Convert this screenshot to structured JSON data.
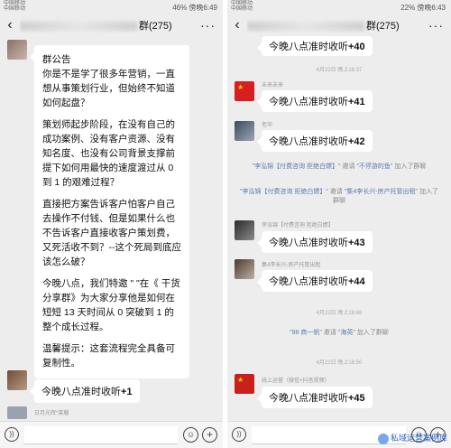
{
  "left": {
    "status": {
      "carrier_line1": "中国移动",
      "carrier_line2": "中国移动",
      "right": "46% 傍晚6:49"
    },
    "title": "群(275)",
    "announcement": {
      "heading": "群公告",
      "paragraphs": [
        "你是不是学了很多年营销，一直想从事策划行业，但始终不知道如何起盘？",
        "策划师起步阶段，在没有自己的成功案例、没有客户资源、没有知名度、也没有公司背景支撑前提下如何用最快的速度渡过从 0 到 1 的艰难过程？",
        "直接把方案告诉客户怕客户自己去操作不付钱、但是如果什么也不告诉客户直接收客户策划费，又死活收不到？--这个死局到底应该怎么破？",
        "今晚八点，我们特邀     \"    \"在《      干货分享群》为大家分享他是如何在短短 13 天时间从 0 突破到 1 的整个成长过程。",
        "温馨提示：这套流程完全具备可复制性。"
      ]
    },
    "message": {
      "text": "今晚八点准时收听",
      "plus": "+1"
    },
    "next_sender": "日月光辉*莱菔"
  },
  "right": {
    "status": {
      "carrier_line1": "中国移动",
      "carrier_line2": "中国移动",
      "right": "22% 傍晚6:43"
    },
    "title": "群(275)",
    "top_message": {
      "text": "今晚八点准时收听",
      "plus": "+40"
    },
    "items": [
      {
        "type": "time",
        "text": "4月22日 晚上18:37"
      },
      {
        "type": "msg",
        "sender": "未来未来",
        "text": "今晚八点准时收听",
        "plus": "+41"
      },
      {
        "type": "msg",
        "sender": "老毕",
        "text": "今晚八点准时收听",
        "plus": "+42"
      },
      {
        "type": "sys",
        "blue1": "\"李泓锦【付费咨询 拒绝白嫖】\"",
        "gray1": "邀请",
        "blue2": "\"不停游的鱼\"",
        "gray2": "加入了群聊"
      },
      {
        "type": "sys",
        "blue1": "\"李泓锦【付费咨询 拒绝白嫖】\"",
        "gray1": "邀请",
        "blue2": "\"集4李长兴-房产托管出租\"",
        "gray2": "加入了群聊"
      },
      {
        "type": "msg",
        "sender": "李泓锦【付费咨询 拒绝白嫖】",
        "text": "今晚八点准时收听",
        "plus": "+43"
      },
      {
        "type": "msg",
        "sender": "集4李长兴-房产托管出租",
        "text": "今晚八点准时收听",
        "plus": "+44"
      },
      {
        "type": "time",
        "text": "4月22日 晚上18:48"
      },
      {
        "type": "sys",
        "blue1": "\"88 商一帆\"",
        "gray1": "邀请",
        "blue2": "\"海英\"",
        "gray2": "加入了群聊"
      },
      {
        "type": "time",
        "text": "4月22日 晚上18:50"
      },
      {
        "type": "msg",
        "sender": "线上运营（微信+抖音视频）",
        "text": "今晚八点准时收听",
        "plus": "+45"
      }
    ],
    "watermark": "私域运营案例库"
  },
  "colors": {
    "bg": "#ededed",
    "bubble": "#ffffff",
    "blue": "#5b7cb3"
  },
  "icons": {
    "back": "back-arrow-icon",
    "more": "more-dots-icon",
    "voice": "voice-icon",
    "emoji": "emoji-icon",
    "plus": "plus-icon"
  }
}
